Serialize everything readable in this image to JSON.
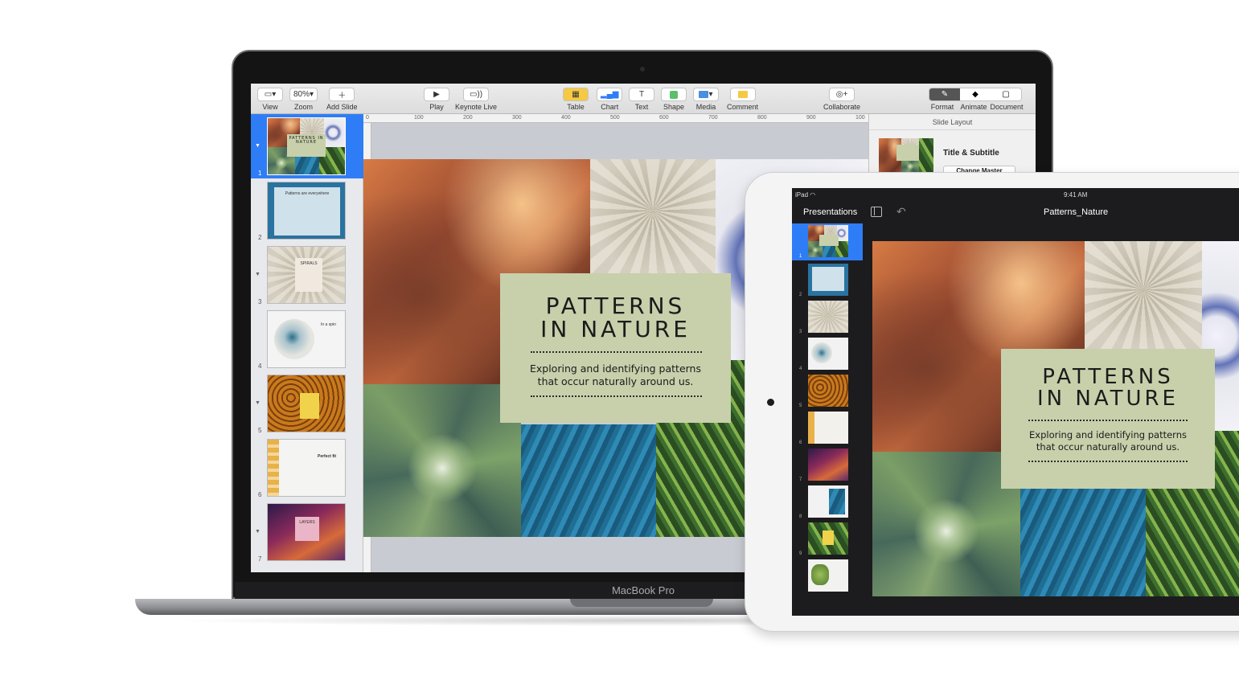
{
  "mac": {
    "brand": "MacBook Pro",
    "toolbar": {
      "view": "View",
      "zoom_value": "80%",
      "zoom": "Zoom",
      "add_slide": "Add Slide",
      "play": "Play",
      "keynote_live": "Keynote Live",
      "table": "Table",
      "chart": "Chart",
      "text": "Text",
      "shape": "Shape",
      "media": "Media",
      "comment": "Comment",
      "collaborate": "Collaborate",
      "format": "Format",
      "animate": "Animate",
      "document": "Document"
    },
    "ruler": [
      "0",
      "100",
      "200",
      "300",
      "400",
      "500",
      "600",
      "700",
      "800",
      "900",
      "100"
    ],
    "slides": [
      "1",
      "2",
      "3",
      "4",
      "5",
      "6",
      "7"
    ],
    "thumb_texts": {
      "s1": "PATTERNS IN NATURE",
      "s2": "Patterns are everywhere",
      "s3": "SPIRALS",
      "s4": "In a spin",
      "s6": "Perfect fit",
      "s7": "LAYERS"
    },
    "inspector": {
      "header": "Slide Layout",
      "layout_name": "Title & Subtitle",
      "change_master": "Change Master"
    }
  },
  "slide": {
    "title_line1": "PATTERNS",
    "title_line2": "IN NATURE",
    "subtitle": "Exploring and identifying patterns that occur naturally around us."
  },
  "ipad": {
    "status_left": "iPad",
    "status_time": "9:41 AM",
    "back": "Presentations",
    "doc_title": "Patterns_Nature",
    "slides": [
      "1",
      "2",
      "3",
      "4",
      "5",
      "6",
      "7",
      "8",
      "9"
    ],
    "add": "+"
  },
  "colors": {
    "accent": "#2f7df6",
    "title_card": "#c7d0ab"
  }
}
